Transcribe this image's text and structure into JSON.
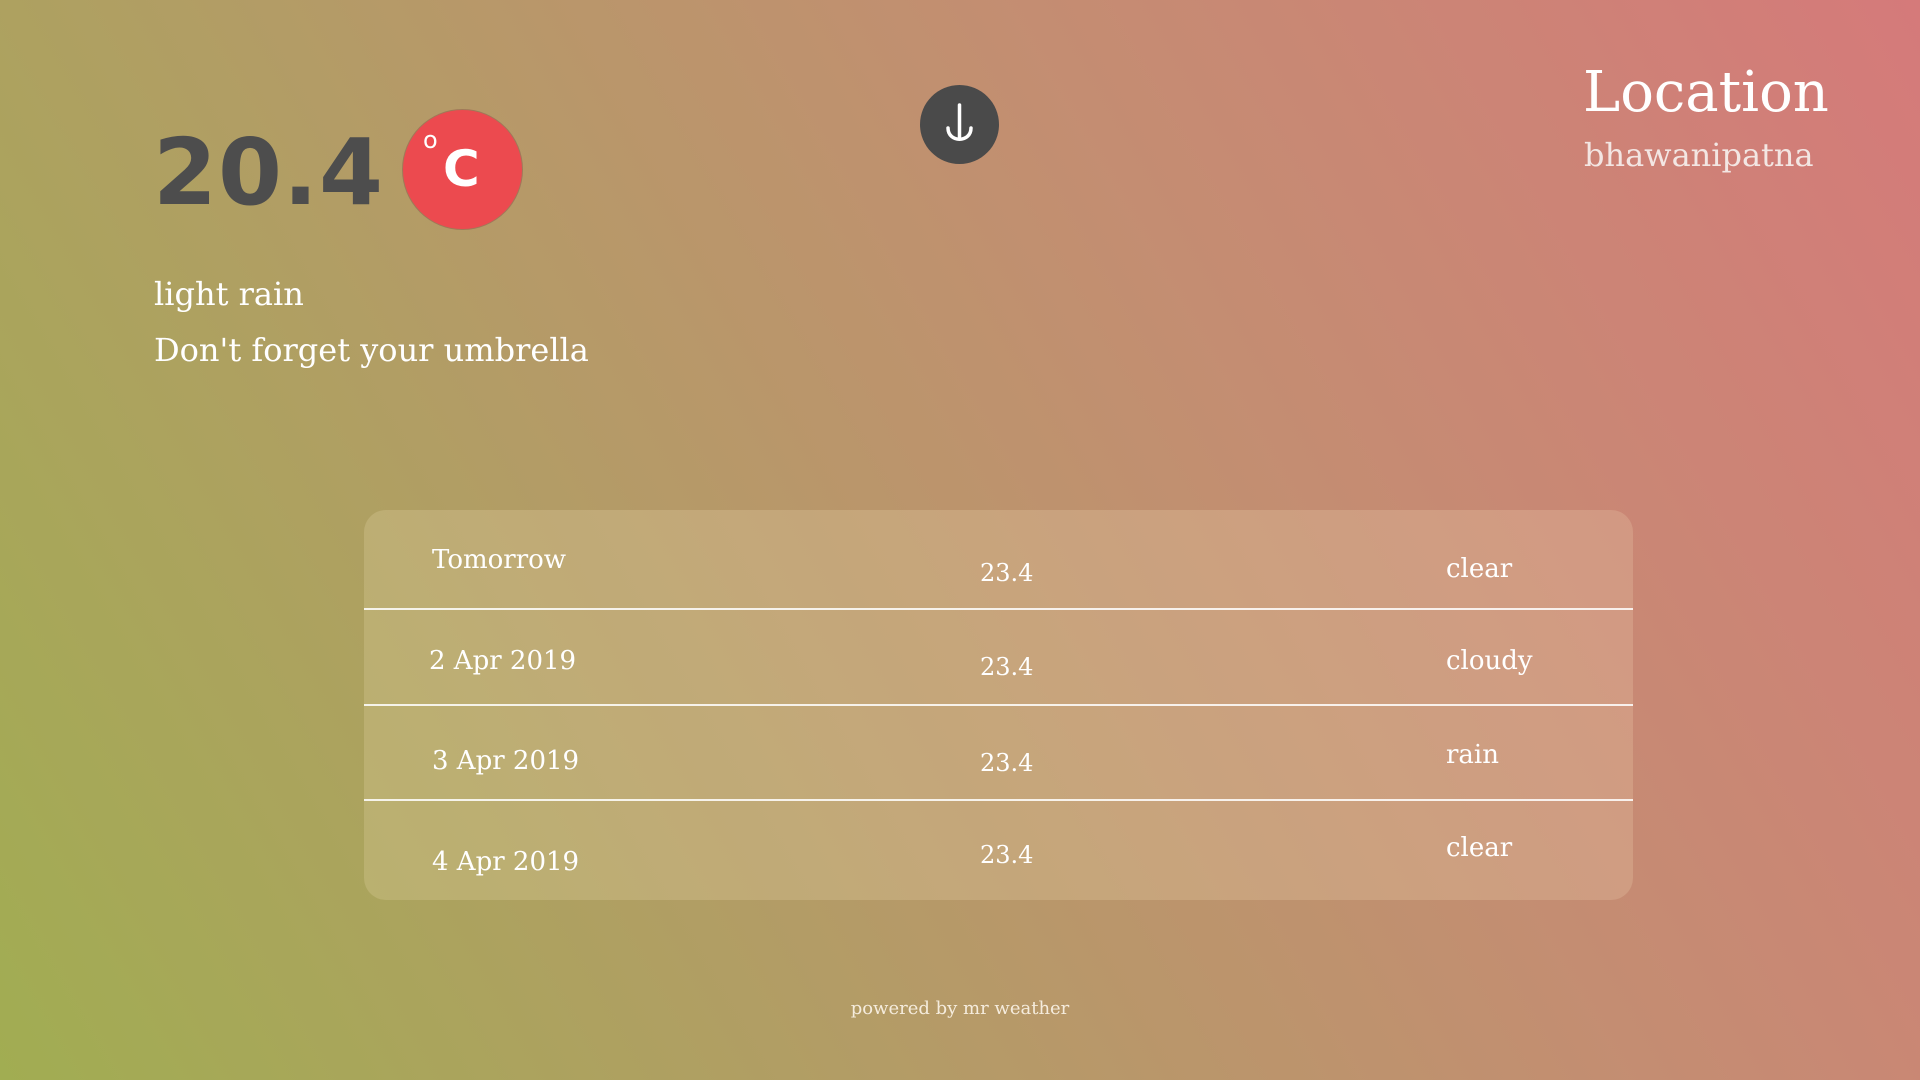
{
  "current": {
    "temperature": "20.4",
    "unit_degree_symbol": "o",
    "unit_letter": "C",
    "unit_button_color": "#ec4a4f",
    "condition": "light rain",
    "advice": "Don't forget your umbrella"
  },
  "scroll_down_icon": "arrow-down-icon",
  "location": {
    "heading": "Location",
    "name": "bhawanipatna"
  },
  "forecast": [
    {
      "day": "Tomorrow",
      "temp": "23.4",
      "condition": "clear"
    },
    {
      "day": "2 Apr 2019",
      "temp": "23.4",
      "condition": "cloudy"
    },
    {
      "day": "3 Apr 2019",
      "temp": "23.4",
      "condition": "rain"
    },
    {
      "day": "4 Apr 2019",
      "temp": "23.4",
      "condition": "clear"
    }
  ],
  "footer": "powered by mr weather",
  "colors": {
    "gradient_start": "#a1ad52",
    "gradient_end": "#d57a7a",
    "temperature_text": "#4d4d4d",
    "scroll_button": "#4a4a4a"
  }
}
